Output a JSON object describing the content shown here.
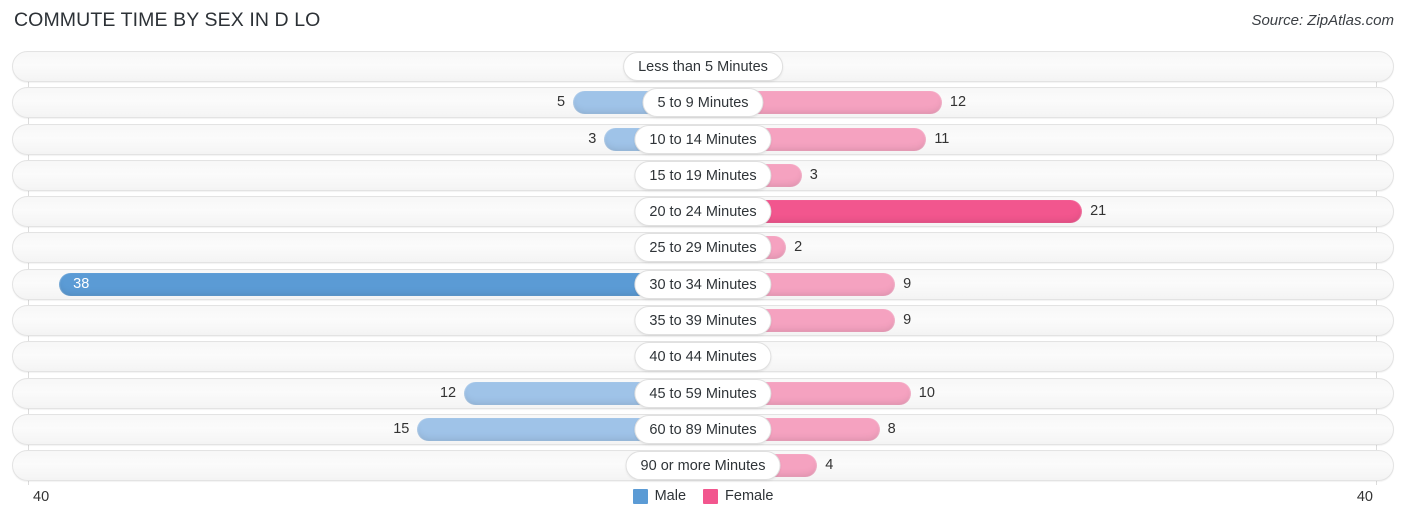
{
  "header": {
    "title": "COMMUTE TIME BY SEX IN D LO",
    "source": "Source: ZipAtlas.com"
  },
  "legend": {
    "male_label": "Male",
    "female_label": "Female",
    "male_color": "#5B9BD5",
    "female_color": "#F2568E"
  },
  "axis": {
    "left_tick": "40",
    "right_tick": "40",
    "max": 40
  },
  "colors": {
    "male_base": "#9fc3e8",
    "male_zero": "#aecbeb",
    "male_max": "#5B9BD5",
    "female_base": "#f5a2c0",
    "female_zero": "#f4a7c3",
    "female_max": "#F2568E",
    "track": "#f7f7f7",
    "gridline": "#dcdcdc"
  },
  "chart_data": {
    "type": "bar",
    "orientation": "horizontal-diverging",
    "title": "COMMUTE TIME BY SEX IN D LO",
    "xlabel": "",
    "ylabel": "",
    "xlim": [
      40,
      40
    ],
    "grid": true,
    "legend_position": "bottom-center",
    "categories": [
      "Less than 5 Minutes",
      "5 to 9 Minutes",
      "10 to 14 Minutes",
      "15 to 19 Minutes",
      "20 to 24 Minutes",
      "25 to 29 Minutes",
      "30 to 34 Minutes",
      "35 to 39 Minutes",
      "40 to 44 Minutes",
      "45 to 59 Minutes",
      "60 to 89 Minutes",
      "90 or more Minutes"
    ],
    "series": [
      {
        "name": "Male",
        "values": [
          0,
          5,
          3,
          0,
          0,
          0,
          38,
          0,
          0,
          12,
          15,
          0
        ]
      },
      {
        "name": "Female",
        "values": [
          0,
          12,
          11,
          3,
          21,
          2,
          9,
          9,
          0,
          10,
          8,
          4
        ]
      }
    ]
  },
  "rows": [
    {
      "category": "Less than 5 Minutes",
      "male": "0",
      "female": "0",
      "male_value": 0,
      "female_value": 0
    },
    {
      "category": "5 to 9 Minutes",
      "male": "5",
      "female": "12",
      "male_value": 5,
      "female_value": 12
    },
    {
      "category": "10 to 14 Minutes",
      "male": "3",
      "female": "11",
      "male_value": 3,
      "female_value": 11
    },
    {
      "category": "15 to 19 Minutes",
      "male": "0",
      "female": "3",
      "male_value": 0,
      "female_value": 3
    },
    {
      "category": "20 to 24 Minutes",
      "male": "0",
      "female": "21",
      "male_value": 0,
      "female_value": 21
    },
    {
      "category": "25 to 29 Minutes",
      "male": "0",
      "female": "2",
      "male_value": 0,
      "female_value": 2
    },
    {
      "category": "30 to 34 Minutes",
      "male": "38",
      "female": "9",
      "male_value": 38,
      "female_value": 9
    },
    {
      "category": "35 to 39 Minutes",
      "male": "0",
      "female": "9",
      "male_value": 0,
      "female_value": 9
    },
    {
      "category": "40 to 44 Minutes",
      "male": "0",
      "female": "0",
      "male_value": 0,
      "female_value": 0
    },
    {
      "category": "45 to 59 Minutes",
      "male": "12",
      "female": "10",
      "male_value": 12,
      "female_value": 10
    },
    {
      "category": "60 to 89 Minutes",
      "male": "15",
      "female": "8",
      "male_value": 15,
      "female_value": 8
    },
    {
      "category": "90 or more Minutes",
      "male": "0",
      "female": "4",
      "male_value": 0,
      "female_value": 4
    }
  ]
}
